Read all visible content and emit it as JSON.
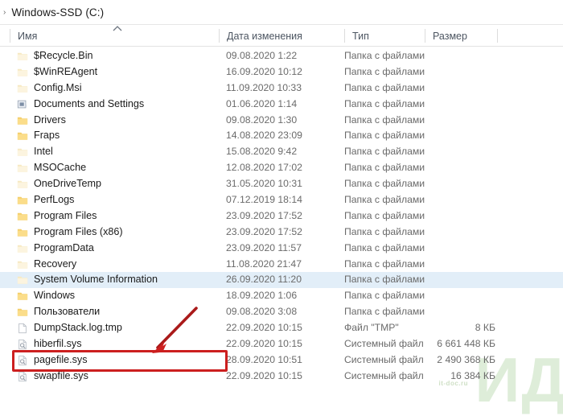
{
  "window": {
    "breadcrumb_chevron": "›",
    "breadcrumb_label": "Windows-SSD (C:)"
  },
  "columns": {
    "name": "Имя",
    "date_modified": "Дата изменения",
    "type": "Тип",
    "size": "Размер",
    "sort_icon": "chevron-up-icon",
    "sort_column": "Имя",
    "sort_direction": "ascending"
  },
  "watermark": {
    "text": "ИД",
    "subtext": "it-doc.ru"
  },
  "annotations": {
    "highlight_row": "hiberfil.sys",
    "highlight_color": "#cc1f1f",
    "arrow_color": "#aa1a1a",
    "selected_row": "System Volume Information",
    "selection_color": "#e2eef8"
  },
  "files": [
    {
      "name": "$Recycle.Bin",
      "date": "09.08.2020 1:22",
      "type": "Папка с файлами",
      "size": "",
      "icon": "folder-pale-icon",
      "selected": false
    },
    {
      "name": "$WinREAgent",
      "date": "16.09.2020 10:12",
      "type": "Папка с файлами",
      "size": "",
      "icon": "folder-pale-icon",
      "selected": false
    },
    {
      "name": "Config.Msi",
      "date": "11.09.2020 10:33",
      "type": "Папка с файлами",
      "size": "",
      "icon": "folder-pale-icon",
      "selected": false
    },
    {
      "name": "Documents and Settings",
      "date": "01.06.2020 1:14",
      "type": "Папка с файлами",
      "size": "",
      "icon": "junction-icon",
      "selected": false
    },
    {
      "name": "Drivers",
      "date": "09.08.2020 1:30",
      "type": "Папка с файлами",
      "size": "",
      "icon": "folder-icon",
      "selected": false
    },
    {
      "name": "Fraps",
      "date": "14.08.2020 23:09",
      "type": "Папка с файлами",
      "size": "",
      "icon": "folder-icon",
      "selected": false
    },
    {
      "name": "Intel",
      "date": "15.08.2020 9:42",
      "type": "Папка с файлами",
      "size": "",
      "icon": "folder-pale-icon",
      "selected": false
    },
    {
      "name": "MSOCache",
      "date": "12.08.2020 17:02",
      "type": "Папка с файлами",
      "size": "",
      "icon": "folder-pale-icon",
      "selected": false
    },
    {
      "name": "OneDriveTemp",
      "date": "31.05.2020 10:31",
      "type": "Папка с файлами",
      "size": "",
      "icon": "folder-pale-icon",
      "selected": false
    },
    {
      "name": "PerfLogs",
      "date": "07.12.2019 18:14",
      "type": "Папка с файлами",
      "size": "",
      "icon": "folder-icon",
      "selected": false
    },
    {
      "name": "Program Files",
      "date": "23.09.2020 17:52",
      "type": "Папка с файлами",
      "size": "",
      "icon": "folder-icon",
      "selected": false
    },
    {
      "name": "Program Files (x86)",
      "date": "23.09.2020 17:52",
      "type": "Папка с файлами",
      "size": "",
      "icon": "folder-icon",
      "selected": false
    },
    {
      "name": "ProgramData",
      "date": "23.09.2020 11:57",
      "type": "Папка с файлами",
      "size": "",
      "icon": "folder-pale-icon",
      "selected": false
    },
    {
      "name": "Recovery",
      "date": "11.08.2020 21:47",
      "type": "Папка с файлами",
      "size": "",
      "icon": "folder-pale-icon",
      "selected": false
    },
    {
      "name": "System Volume Information",
      "date": "26.09.2020 11:20",
      "type": "Папка с файлами",
      "size": "",
      "icon": "folder-pale-icon",
      "selected": true
    },
    {
      "name": "Windows",
      "date": "18.09.2020 1:06",
      "type": "Папка с файлами",
      "size": "",
      "icon": "folder-icon",
      "selected": false
    },
    {
      "name": "Пользователи",
      "date": "09.08.2020 3:08",
      "type": "Папка с файлами",
      "size": "",
      "icon": "folder-icon",
      "selected": false
    },
    {
      "name": "DumpStack.log.tmp",
      "date": "22.09.2020 10:15",
      "type": "Файл \"TMP\"",
      "size": "8 КБ",
      "icon": "file-icon",
      "selected": false
    },
    {
      "name": "hiberfil.sys",
      "date": "22.09.2020 10:15",
      "type": "Системный файл",
      "size": "6 661 448 КБ",
      "icon": "system-file-icon",
      "selected": false
    },
    {
      "name": "pagefile.sys",
      "date": "28.09.2020 10:51",
      "type": "Системный файл",
      "size": "2 490 368 КБ",
      "icon": "system-file-icon",
      "selected": false
    },
    {
      "name": "swapfile.sys",
      "date": "22.09.2020 10:15",
      "type": "Системный файл",
      "size": "16 384 КБ",
      "icon": "system-file-icon",
      "selected": false
    }
  ]
}
